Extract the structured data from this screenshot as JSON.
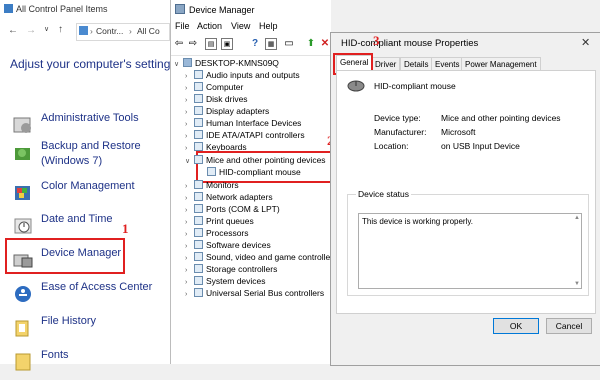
{
  "control_panel": {
    "title": "All Control Panel Items",
    "address_part1": "Contr...",
    "address_part2": "All Co",
    "heading": "Adjust your computer's settings",
    "items": [
      {
        "label": "Administrative Tools",
        "icon": "admin-tools-icon"
      },
      {
        "label": "Backup and Restore\n(Windows 7)",
        "icon": "backup-icon"
      },
      {
        "label": "Color Management",
        "icon": "color-management-icon"
      },
      {
        "label": "Date and Time",
        "icon": "clock-icon"
      },
      {
        "label": "Device Manager",
        "icon": "device-manager-icon"
      },
      {
        "label": "Ease of Access Center",
        "icon": "ease-of-access-icon"
      },
      {
        "label": "File History",
        "icon": "file-history-icon"
      },
      {
        "label": "Fonts",
        "icon": "fonts-icon"
      }
    ],
    "step_number": "1"
  },
  "device_manager": {
    "title": "Device Manager",
    "menu": [
      "File",
      "Action",
      "View",
      "Help"
    ],
    "computer": "DESKTOP-KMNS09Q",
    "categories": [
      "Audio inputs and outputs",
      "Computer",
      "Disk drives",
      "Display adapters",
      "Human Interface Devices",
      "IDE ATA/ATAPI controllers",
      "Keyboards",
      "Mice and other pointing devices",
      "HID-compliant mouse",
      "Monitors",
      "Network adapters",
      "Ports (COM & LPT)",
      "Print queues",
      "Processors",
      "Software devices",
      "Sound, video and game controllers",
      "Storage controllers",
      "System devices",
      "Universal Serial Bus controllers"
    ],
    "step_number": "2"
  },
  "properties": {
    "title": "HID-compliant mouse Properties",
    "close_glyph": "✕",
    "tabs": [
      "General",
      "Driver",
      "Details",
      "Events",
      "Power Management"
    ],
    "device_name": "HID-compliant mouse",
    "rows": [
      {
        "label": "Device type:",
        "value": "Mice and other pointing devices"
      },
      {
        "label": "Manufacturer:",
        "value": "Microsoft"
      },
      {
        "label": "Location:",
        "value": "on USB Input Device"
      }
    ],
    "status_legend": "Device status",
    "status_text": "This device is working properly.",
    "ok_label": "OK",
    "cancel_label": "Cancel",
    "step_number": "3"
  }
}
